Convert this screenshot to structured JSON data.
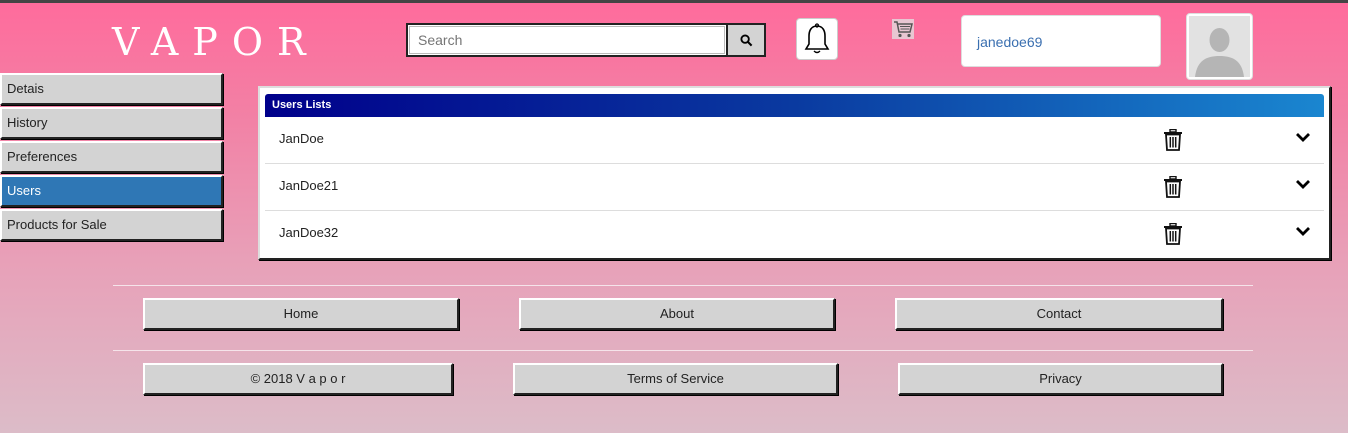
{
  "header": {
    "logo": "VAPOR",
    "search_placeholder": "Search",
    "username": "janedoe69",
    "icons": [
      "search-icon",
      "bell-icon",
      "cart-icon",
      "avatar-icon"
    ]
  },
  "sidebar": {
    "items": [
      {
        "label": "Detais"
      },
      {
        "label": "History"
      },
      {
        "label": "Preferences"
      },
      {
        "label": "Users",
        "active": true
      },
      {
        "label": "Products for Sale"
      }
    ]
  },
  "users_panel": {
    "title": "Users Lists",
    "rows": [
      {
        "name": "JanDoe"
      },
      {
        "name": "JanDoe21"
      },
      {
        "name": "JanDoe32"
      }
    ]
  },
  "footer": {
    "nav": [
      "Home",
      "About",
      "Contact"
    ],
    "copyright": "© 2018 V a p o r",
    "terms": "Terms of Service",
    "privacy": "Privacy"
  },
  "colors": {
    "active_item": "#2f77b5",
    "header_gradient_start": "#00008b",
    "header_gradient_end": "#1a86d0",
    "username_text": "#3a6fb0"
  }
}
